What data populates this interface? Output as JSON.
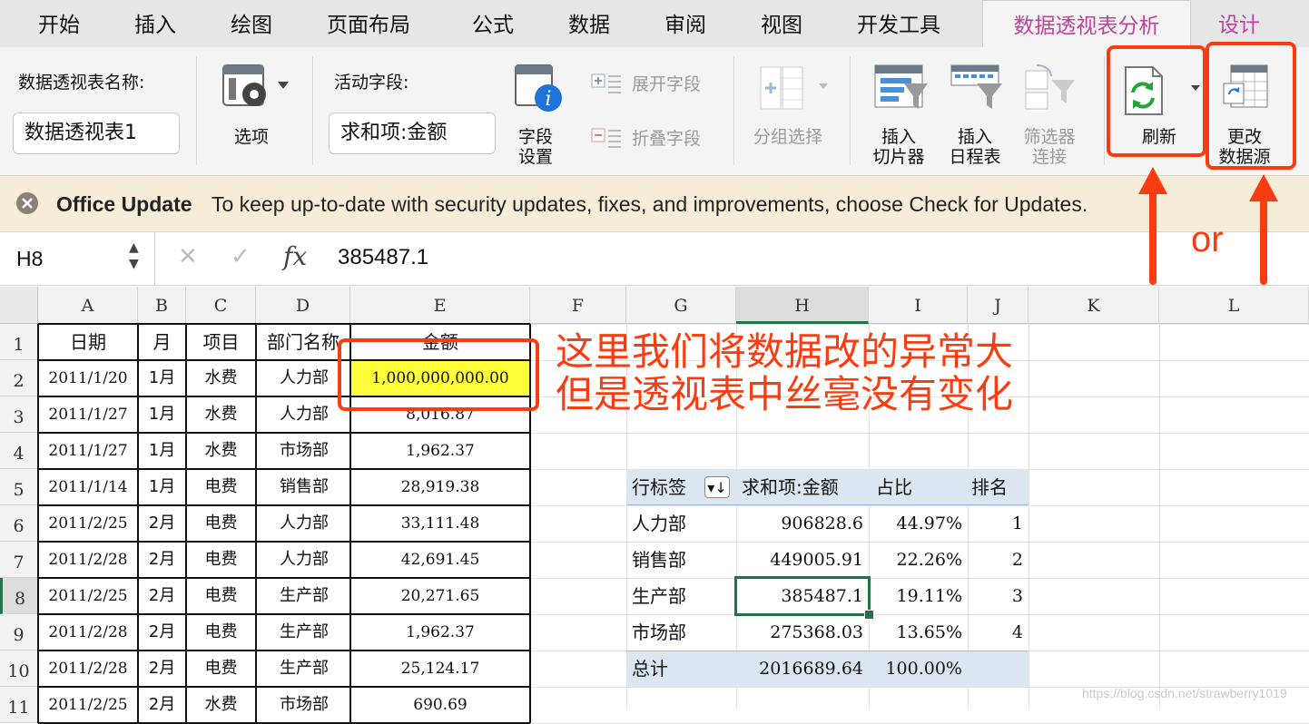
{
  "tabs": [
    "开始",
    "插入",
    "绘图",
    "页面布局",
    "公式",
    "数据",
    "审阅",
    "视图",
    "开发工具",
    "数据透视表分析",
    "设计"
  ],
  "ribbon": {
    "pivot_name_label": "数据透视表名称:",
    "pivot_name_value": "数据透视表1",
    "options": "选项",
    "active_field_label": "活动字段:",
    "active_field_value": "求和项:金额",
    "field_settings_1": "字段",
    "field_settings_2": "设置",
    "expand_field": "展开字段",
    "collapse_field": "折叠字段",
    "group_selection": "分组选择",
    "insert_slicer_1": "插入",
    "insert_slicer_2": "切片器",
    "insert_timeline_1": "插入",
    "insert_timeline_2": "日程表",
    "filter_conn_1": "筛选器",
    "filter_conn_2": "连接",
    "refresh": "刷新",
    "change_source_1": "更改",
    "change_source_2": "数据源"
  },
  "notice": {
    "title": "Office Update",
    "message": "To keep up-to-date with security updates, fixes, and improvements, choose Check for Updates."
  },
  "formula_bar": {
    "name_box": "H8",
    "fx": "fx",
    "value": "385487.1"
  },
  "columns": [
    "A",
    "B",
    "C",
    "D",
    "E",
    "F",
    "G",
    "H",
    "I",
    "J",
    "K",
    "L"
  ],
  "rows": [
    "1",
    "2",
    "3",
    "4",
    "5",
    "6",
    "7",
    "8",
    "9",
    "10",
    "11"
  ],
  "table_headers": [
    "日期",
    "月",
    "项目",
    "部门名称",
    "金额"
  ],
  "table_rows": [
    [
      "2011/1/20",
      "1月",
      "水费",
      "人力部",
      "1,000,000,000.00"
    ],
    [
      "2011/1/27",
      "1月",
      "水费",
      "人力部",
      "8,016.87"
    ],
    [
      "2011/1/27",
      "1月",
      "水费",
      "市场部",
      "1,962.37"
    ],
    [
      "2011/1/14",
      "1月",
      "电费",
      "销售部",
      "28,919.38"
    ],
    [
      "2011/2/25",
      "2月",
      "电费",
      "人力部",
      "33,111.48"
    ],
    [
      "2011/2/28",
      "2月",
      "电费",
      "人力部",
      "42,691.45"
    ],
    [
      "2011/2/25",
      "2月",
      "电费",
      "生产部",
      "20,271.65"
    ],
    [
      "2011/2/28",
      "2月",
      "电费",
      "生产部",
      "1,962.37"
    ],
    [
      "2011/2/28",
      "2月",
      "电费",
      "生产部",
      "25,124.17"
    ],
    [
      "2011/2/25",
      "2月",
      "水费",
      "市场部",
      "690.69"
    ]
  ],
  "pivot": {
    "headers": [
      "行标签",
      "求和项:金额",
      "占比",
      "排名"
    ],
    "rows": [
      [
        "人力部",
        "906828.6",
        "44.97%",
        "1"
      ],
      [
        "销售部",
        "449005.91",
        "22.26%",
        "2"
      ],
      [
        "生产部",
        "385487.1",
        "19.11%",
        "3"
      ],
      [
        "市场部",
        "275368.03",
        "13.65%",
        "4"
      ]
    ],
    "total": [
      "总计",
      "2016689.64",
      "100.00%"
    ]
  },
  "annotation": {
    "line1": "这里我们将数据改的异常大",
    "line2": "但是透视表中丝毫没有变化",
    "or": "or",
    "color": "#fa3c10"
  },
  "watermark": "https://blog.csdn.net/strawberry1019"
}
